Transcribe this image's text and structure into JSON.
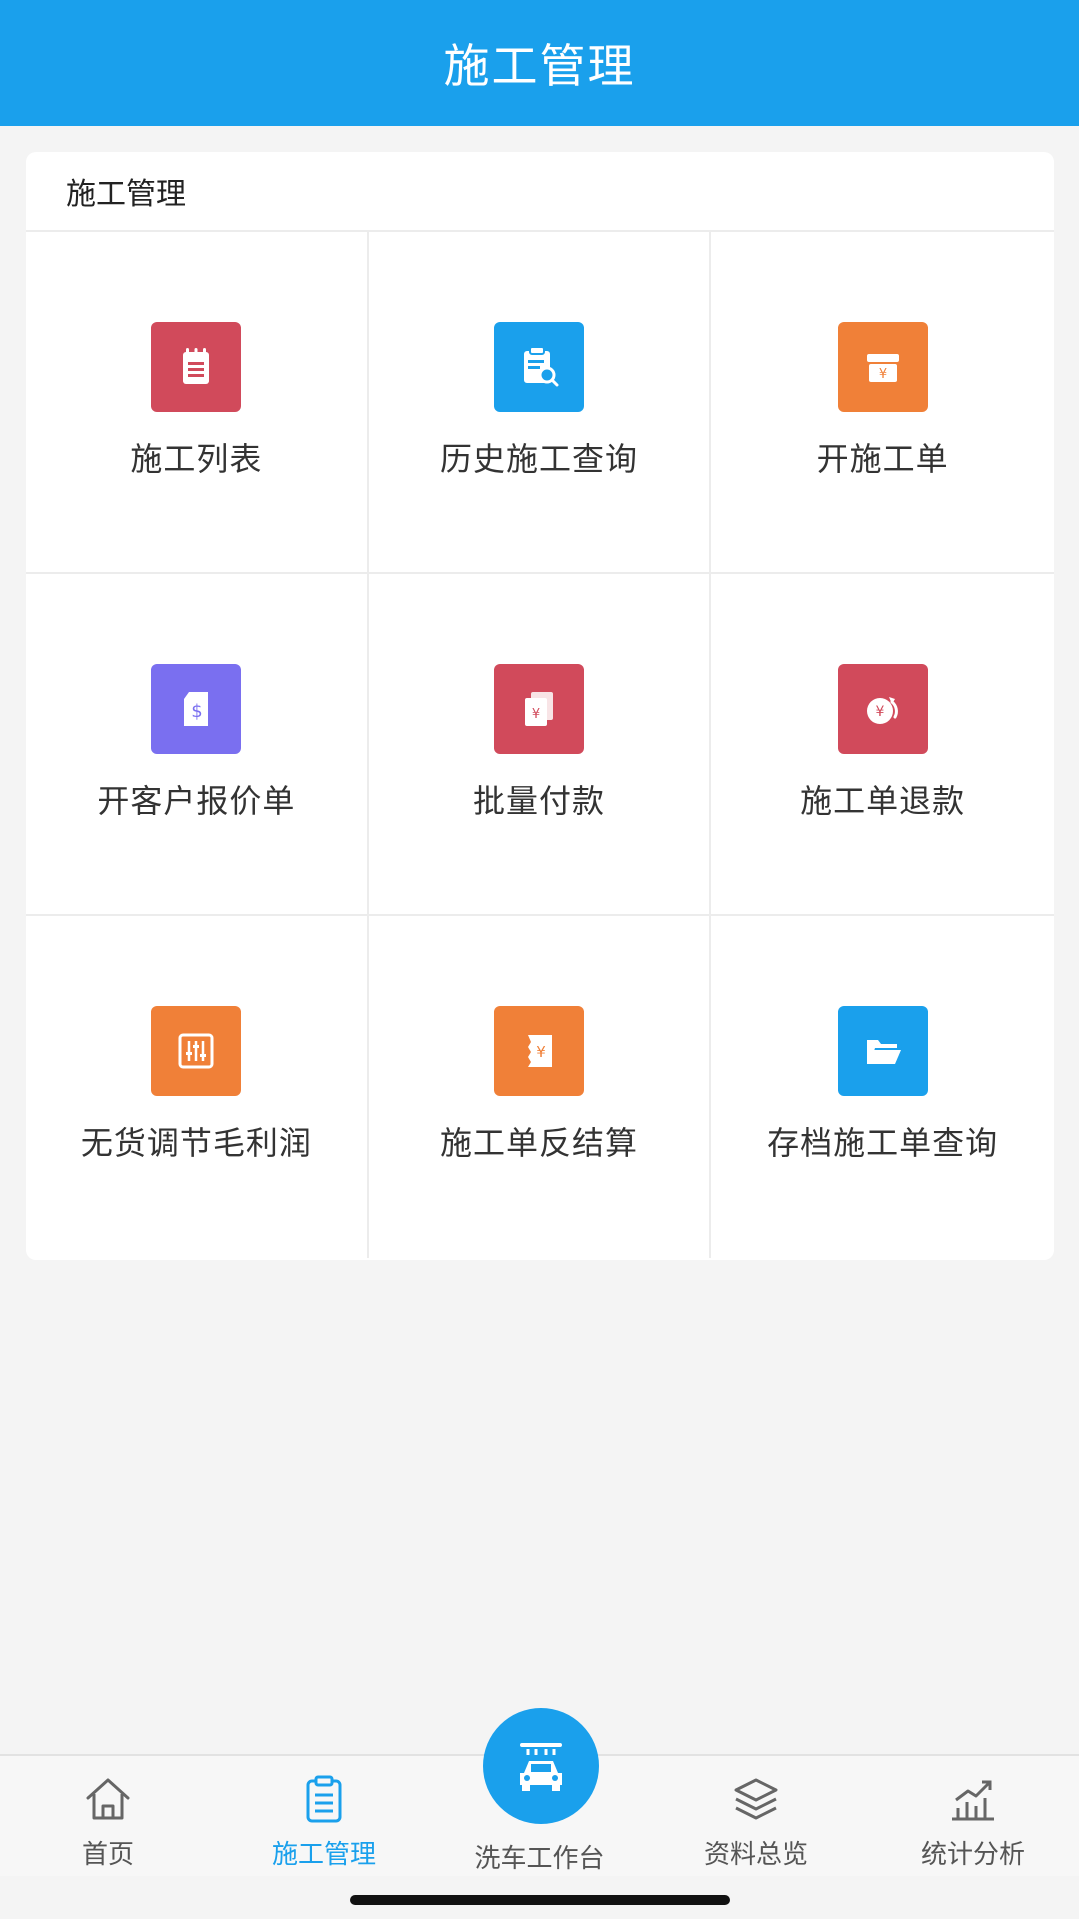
{
  "header": {
    "title": "施工管理"
  },
  "section": {
    "title": "施工管理"
  },
  "menu": [
    {
      "label": "施工列表",
      "icon": "notepad-icon",
      "color": "#d14a5b"
    },
    {
      "label": "历史施工查询",
      "icon": "clipboard-search-icon",
      "color": "#1aa0ec"
    },
    {
      "label": "开施工单",
      "icon": "yuan-box-icon",
      "color": "#f08038"
    },
    {
      "label": "开客户报价单",
      "icon": "dollar-document-icon",
      "color": "#7a6ff0"
    },
    {
      "label": "批量付款",
      "icon": "yuan-documents-icon",
      "color": "#d14a5b"
    },
    {
      "label": "施工单退款",
      "icon": "yuan-refund-icon",
      "color": "#d14a5b"
    },
    {
      "label": "无货调节毛利润",
      "icon": "sliders-icon",
      "color": "#f08038"
    },
    {
      "label": "施工单反结算",
      "icon": "yuan-receipt-icon",
      "color": "#f08038"
    },
    {
      "label": "存档施工单查询",
      "icon": "folder-icon",
      "color": "#1aa0ec"
    }
  ],
  "tabbar": {
    "active_color": "#1aa0ec",
    "items": [
      {
        "label": "首页",
        "icon": "home-icon"
      },
      {
        "label": "施工管理",
        "icon": "clipboard-icon",
        "active": true
      },
      {
        "label": "洗车工作台",
        "icon": "car-wash-icon"
      },
      {
        "label": "资料总览",
        "icon": "layers-icon"
      },
      {
        "label": "统计分析",
        "icon": "chart-icon"
      }
    ]
  }
}
